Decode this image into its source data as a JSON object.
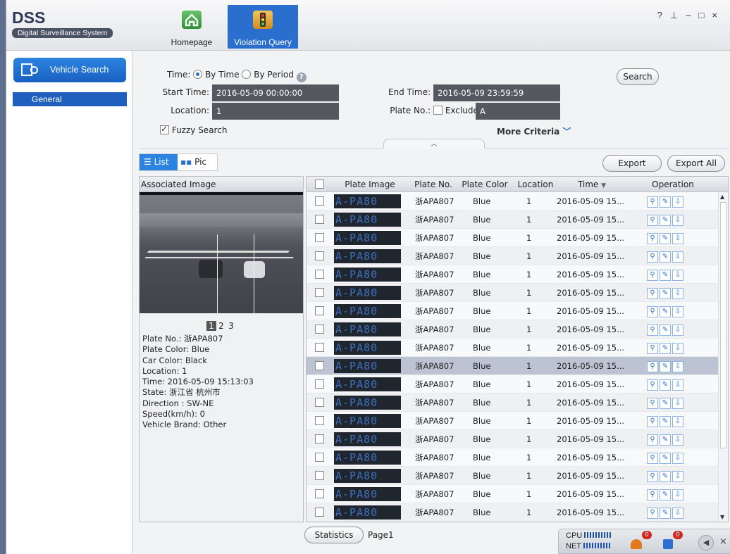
{
  "app": {
    "title": "DSS",
    "subtitle": "Digital Surveillance System"
  },
  "tabs": [
    {
      "label": "Homepage",
      "icon": "home-icon"
    },
    {
      "label": "Violation Query",
      "icon": "traffic-light-icon",
      "active": true
    }
  ],
  "window_controls": [
    "?",
    "⊥",
    "–",
    "□",
    "×"
  ],
  "sidebar": {
    "vehicle_search": "Vehicle Search",
    "general": "General"
  },
  "form": {
    "time_label": "Time:",
    "by_time": "By Time",
    "by_period": "By Period",
    "start_time_label": "Start Time:",
    "start_time": "2016-05-09 00:00:00",
    "end_time_label": "End Time:",
    "end_time": "2016-05-09 23:59:59",
    "location_label": "Location:",
    "location": "1",
    "plate_label": "Plate No.:",
    "exclude": "Exclude",
    "plate": "A",
    "fuzzy": "Fuzzy Search",
    "more": "More Criteria",
    "search": "Search"
  },
  "view": {
    "list": "List",
    "pic": "Pic",
    "export": "Export",
    "export_all": "Export All"
  },
  "assoc": {
    "title": "Associated Image",
    "pages": [
      "1",
      "2",
      "3"
    ],
    "info": [
      "Plate No.: 浙APA807",
      "Plate Color: Blue",
      "Car Color: Black",
      "Location: 1",
      "Time: 2016-05-09 15:13:03",
      "State: 浙江省 杭州市",
      "Direction : SW-NE",
      "Speed(km/h): 0",
      "Vehicle Brand: Other"
    ]
  },
  "table": {
    "headers": [
      "Plate Image",
      "Plate No.",
      "Plate Color",
      "Location",
      "Time",
      "Operation"
    ],
    "plate_image_text": "A-PA80",
    "rows": [
      {
        "plate": "浙APA807",
        "color": "Blue",
        "loc": "1",
        "time": "2016-05-09 15..."
      },
      {
        "plate": "浙APA807",
        "color": "Blue",
        "loc": "1",
        "time": "2016-05-09 15..."
      },
      {
        "plate": "浙APA807",
        "color": "Blue",
        "loc": "1",
        "time": "2016-05-09 15..."
      },
      {
        "plate": "浙APA807",
        "color": "Blue",
        "loc": "1",
        "time": "2016-05-09 15..."
      },
      {
        "plate": "浙APA807",
        "color": "Blue",
        "loc": "1",
        "time": "2016-05-09 15..."
      },
      {
        "plate": "浙APA807",
        "color": "Blue",
        "loc": "1",
        "time": "2016-05-09 15..."
      },
      {
        "plate": "浙APA807",
        "color": "Blue",
        "loc": "1",
        "time": "2016-05-09 15..."
      },
      {
        "plate": "浙APA807",
        "color": "Blue",
        "loc": "1",
        "time": "2016-05-09 15..."
      },
      {
        "plate": "浙APA807",
        "color": "Blue",
        "loc": "1",
        "time": "2016-05-09 15..."
      },
      {
        "plate": "浙APA807",
        "color": "Blue",
        "loc": "1",
        "time": "2016-05-09 15...",
        "selected": true
      },
      {
        "plate": "浙APA807",
        "color": "Blue",
        "loc": "1",
        "time": "2016-05-09 15..."
      },
      {
        "plate": "浙APA807",
        "color": "Blue",
        "loc": "1",
        "time": "2016-05-09 15..."
      },
      {
        "plate": "浙APA807",
        "color": "Blue",
        "loc": "1",
        "time": "2016-05-09 15..."
      },
      {
        "plate": "浙APA807",
        "color": "Blue",
        "loc": "1",
        "time": "2016-05-09 15..."
      },
      {
        "plate": "浙APA807",
        "color": "Blue",
        "loc": "1",
        "time": "2016-05-09 15..."
      },
      {
        "plate": "浙APA807",
        "color": "Blue",
        "loc": "1",
        "time": "2016-05-09 15..."
      },
      {
        "plate": "浙APA807",
        "color": "Blue",
        "loc": "1",
        "time": "2016-05-09 15..."
      },
      {
        "plate": "浙APA807",
        "color": "Blue",
        "loc": "1",
        "time": "2016-05-09 15..."
      }
    ]
  },
  "footer": {
    "statistics": "Statistics",
    "page": "Page1",
    "cpu": "CPU",
    "net": "NET",
    "alarm_count": "0",
    "msg_count": "0"
  },
  "colors": {
    "accent": "#2a6fce",
    "selected_row": "#bcc4d3",
    "input_bg": "#55585e"
  }
}
